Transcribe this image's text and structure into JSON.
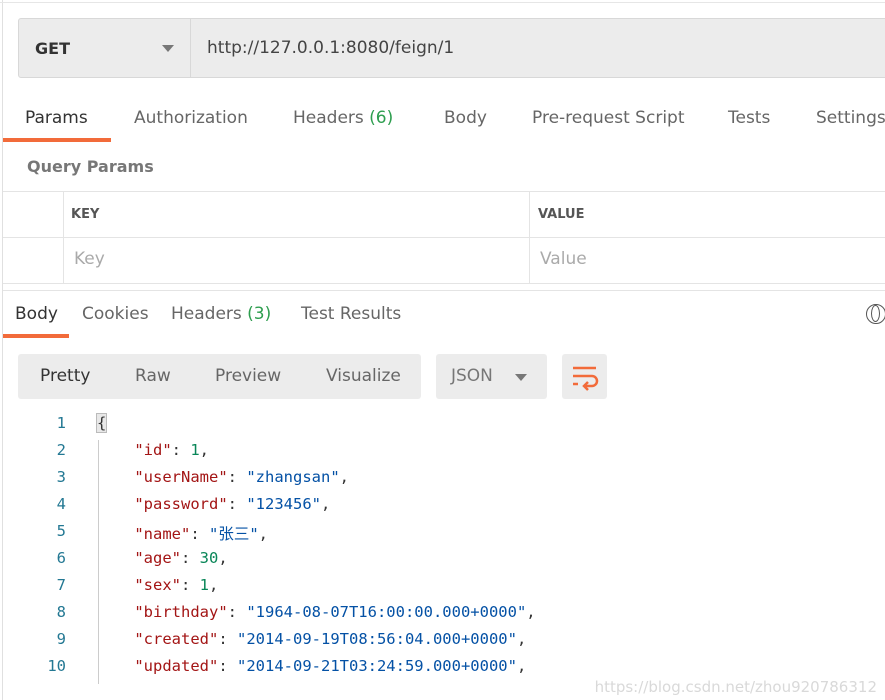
{
  "request": {
    "method": "GET",
    "url": "http://127.0.0.1:8080/feign/1"
  },
  "request_tabs": [
    {
      "label": "Params"
    },
    {
      "label": "Authorization"
    },
    {
      "label": "Headers",
      "count": "(6)"
    },
    {
      "label": "Body"
    },
    {
      "label": "Pre-request Script"
    },
    {
      "label": "Tests"
    },
    {
      "label": "Settings"
    }
  ],
  "query_params": {
    "title": "Query Params",
    "key_header": "KEY",
    "value_header": "VALUE",
    "key_placeholder": "Key",
    "value_placeholder": "Value"
  },
  "response_tabs": [
    {
      "label": "Body"
    },
    {
      "label": "Cookies"
    },
    {
      "label": "Headers",
      "count": "(3)"
    },
    {
      "label": "Test Results"
    }
  ],
  "view_modes": [
    "Pretty",
    "Raw",
    "Preview",
    "Visualize"
  ],
  "format": "JSON",
  "accent": "#f26b3a",
  "code_lines": [
    {
      "n": "1",
      "parts": [
        [
          "p",
          "{"
        ]
      ]
    },
    {
      "n": "2",
      "parts": [
        [
          "p",
          "    "
        ],
        [
          "k",
          "\"id\""
        ],
        [
          "p",
          ": "
        ],
        [
          "n",
          "1"
        ],
        [
          "p",
          ","
        ]
      ]
    },
    {
      "n": "3",
      "parts": [
        [
          "p",
          "    "
        ],
        [
          "k",
          "\"userName\""
        ],
        [
          "p",
          ": "
        ],
        [
          "s",
          "\"zhangsan\""
        ],
        [
          "p",
          ","
        ]
      ]
    },
    {
      "n": "4",
      "parts": [
        [
          "p",
          "    "
        ],
        [
          "k",
          "\"password\""
        ],
        [
          "p",
          ": "
        ],
        [
          "s",
          "\"123456\""
        ],
        [
          "p",
          ","
        ]
      ]
    },
    {
      "n": "5",
      "parts": [
        [
          "p",
          "    "
        ],
        [
          "k",
          "\"name\""
        ],
        [
          "p",
          ": "
        ],
        [
          "s",
          "\"张三\""
        ],
        [
          "p",
          ","
        ]
      ]
    },
    {
      "n": "6",
      "parts": [
        [
          "p",
          "    "
        ],
        [
          "k",
          "\"age\""
        ],
        [
          "p",
          ": "
        ],
        [
          "n",
          "30"
        ],
        [
          "p",
          ","
        ]
      ]
    },
    {
      "n": "7",
      "parts": [
        [
          "p",
          "    "
        ],
        [
          "k",
          "\"sex\""
        ],
        [
          "p",
          ": "
        ],
        [
          "n",
          "1"
        ],
        [
          "p",
          ","
        ]
      ]
    },
    {
      "n": "8",
      "parts": [
        [
          "p",
          "    "
        ],
        [
          "k",
          "\"birthday\""
        ],
        [
          "p",
          ": "
        ],
        [
          "s",
          "\"1964-08-07T16:00:00.000+0000\""
        ],
        [
          "p",
          ","
        ]
      ]
    },
    {
      "n": "9",
      "parts": [
        [
          "p",
          "    "
        ],
        [
          "k",
          "\"created\""
        ],
        [
          "p",
          ": "
        ],
        [
          "s",
          "\"2014-09-19T08:56:04.000+0000\""
        ],
        [
          "p",
          ","
        ]
      ]
    },
    {
      "n": "10",
      "parts": [
        [
          "p",
          "    "
        ],
        [
          "k",
          "\"updated\""
        ],
        [
          "p",
          ": "
        ],
        [
          "s",
          "\"2014-09-21T03:24:59.000+0000\""
        ],
        [
          "p",
          ","
        ]
      ]
    }
  ],
  "watermark": "https://blog.csdn.net/zhou920786312"
}
